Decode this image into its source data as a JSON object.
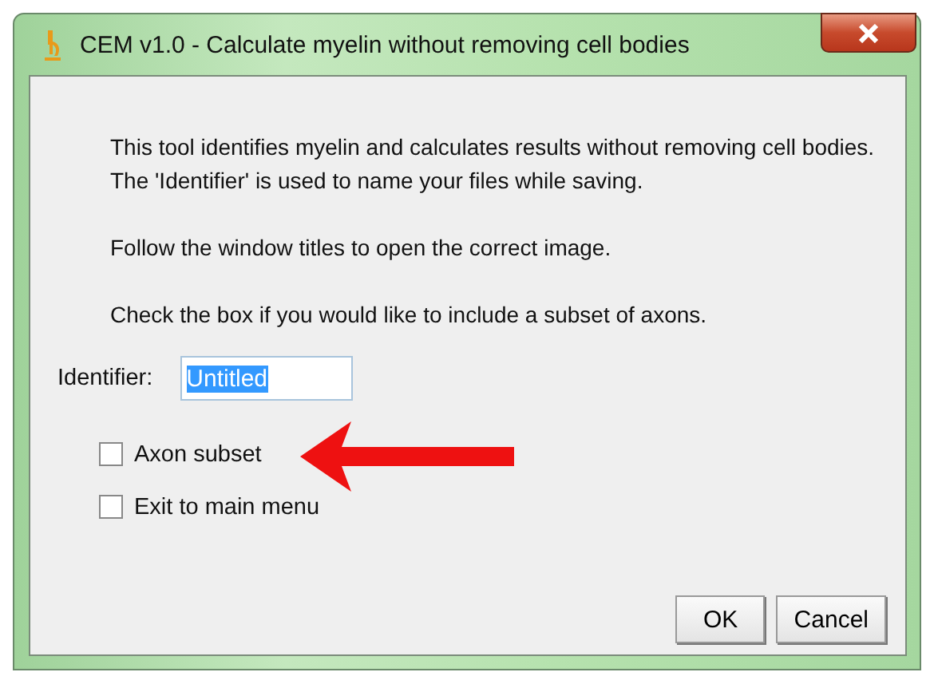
{
  "window": {
    "title": "CEM v1.0 - Calculate myelin without removing cell bodies"
  },
  "paragraphs": [
    "This tool identifies myelin and calculates results without removing cell bodies. The 'Identifier' is used to name your files while saving.",
    "Follow the window titles to open the correct image.",
    "Check the box if you would like to include a subset of axons."
  ],
  "identifier": {
    "label": "Identifier:",
    "value": "Untitled",
    "text_selected": true
  },
  "checkboxes": [
    {
      "label": "Axon subset",
      "checked": false,
      "annotated": true
    },
    {
      "label": "Exit to main menu",
      "checked": false,
      "annotated": false
    }
  ],
  "buttons": [
    "OK",
    "Cancel"
  ]
}
